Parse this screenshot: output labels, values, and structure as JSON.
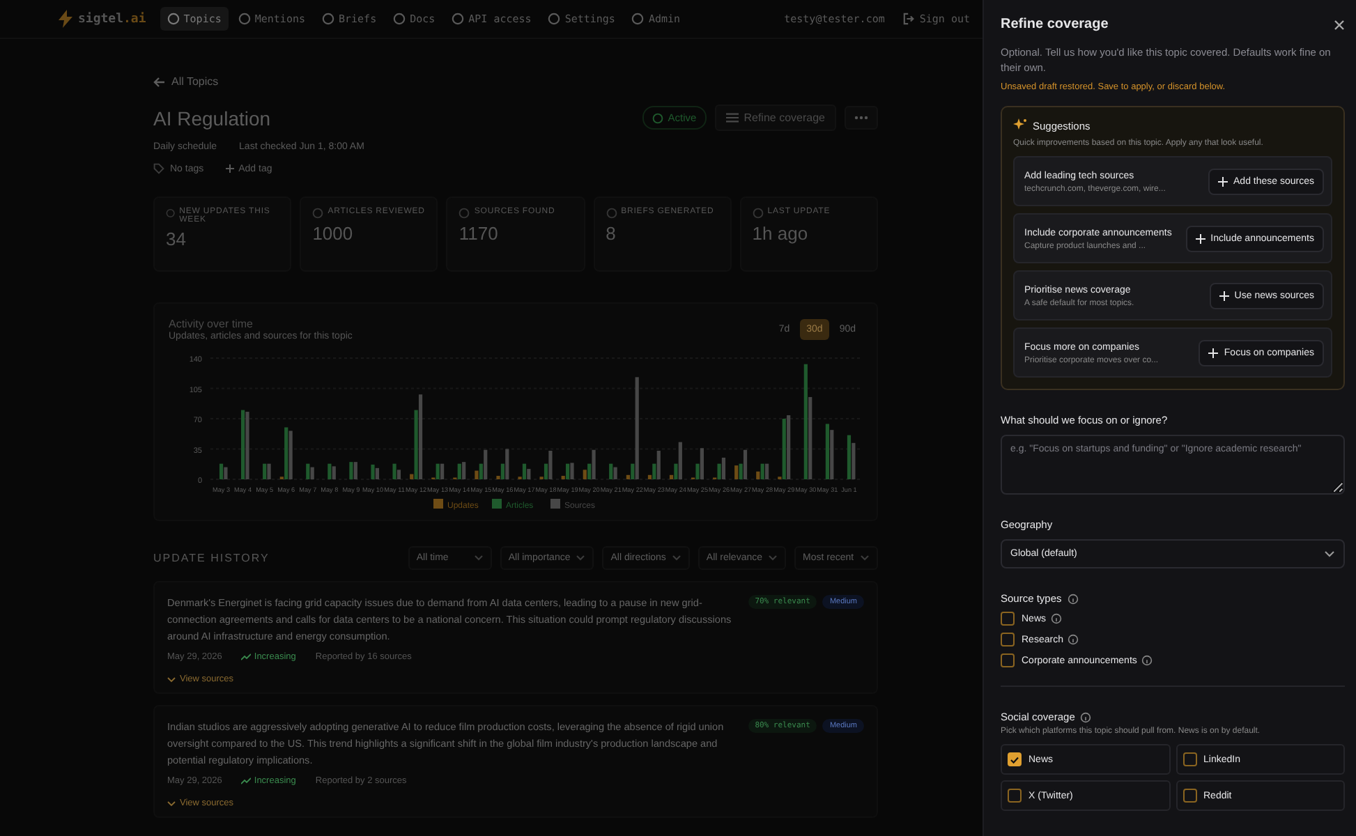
{
  "nav": {
    "logo": {
      "name": "sigtel",
      "suffix": ".ai"
    },
    "items": [
      {
        "label": "Topics",
        "selected": true
      },
      {
        "label": "Mentions",
        "selected": false
      },
      {
        "label": "Briefs",
        "selected": false
      },
      {
        "label": "Docs",
        "selected": false
      },
      {
        "label": "API access",
        "selected": false
      },
      {
        "label": "Settings",
        "selected": false
      },
      {
        "label": "Admin",
        "selected": false
      }
    ],
    "user": "testy@tester.com",
    "sign_out": "Sign out"
  },
  "topic": {
    "back": "All Topics",
    "title": "AI Regulation",
    "status": {
      "label": "Active",
      "active": true
    },
    "refine": "Refine coverage",
    "schedule": "Daily schedule",
    "last_checked": "Last checked Jun 1, 8:00 AM",
    "tags": "No tags",
    "add_tag": "Add tag"
  },
  "stats": [
    {
      "label": "NEW UPDATES THIS WEEK",
      "value": "34"
    },
    {
      "label": "ARTICLES REVIEWED",
      "value": "1000"
    },
    {
      "label": "SOURCES FOUND",
      "value": "1170"
    },
    {
      "label": "BRIEFS GENERATED",
      "value": "8"
    },
    {
      "label": "LAST UPDATE",
      "value": "1h ago"
    }
  ],
  "activity": {
    "title": "Activity over time",
    "subtitle": "Updates, articles and sources for this topic",
    "ranges": [
      {
        "label": "7d",
        "selected": false
      },
      {
        "label": "30d",
        "selected": true
      },
      {
        "label": "90d",
        "selected": false
      }
    ],
    "chart_data": {
      "type": "bar",
      "categories": [
        "May 3",
        "May 4",
        "May 5",
        "May 6",
        "May 7",
        "May 8",
        "May 9",
        "May 10",
        "May 11",
        "May 12",
        "May 13",
        "May 14",
        "May 15",
        "May 16",
        "May 17",
        "May 18",
        "May 19",
        "May 20",
        "May 21",
        "May 22",
        "May 23",
        "May 24",
        "May 25",
        "May 26",
        "May 27",
        "May 28",
        "May 29",
        "May 30",
        "May 31",
        "Jun 1"
      ],
      "series": [
        {
          "name": "Updates",
          "color": "#6e4c15",
          "values": [
            0,
            0,
            0,
            3,
            0,
            0,
            0,
            0,
            0,
            6,
            2,
            2,
            10,
            4,
            3,
            3,
            4,
            11,
            0,
            5,
            5,
            5,
            2,
            2,
            16,
            9,
            3,
            0,
            0,
            0
          ]
        },
        {
          "name": "Articles",
          "color": "#1f5a2d",
          "values": [
            18,
            80,
            18,
            60,
            18,
            18,
            20,
            17,
            18,
            80,
            18,
            18,
            18,
            18,
            18,
            18,
            18,
            18,
            18,
            18,
            18,
            18,
            18,
            18,
            18,
            18,
            70,
            133,
            64,
            51
          ]
        },
        {
          "name": "Sources",
          "color": "#474747",
          "values": [
            14,
            78,
            18,
            56,
            14,
            15,
            20,
            13,
            11,
            98,
            18,
            20,
            34,
            35,
            12,
            33,
            19,
            34,
            14,
            118,
            33,
            43,
            36,
            25,
            34,
            18,
            74,
            95,
            57,
            42
          ]
        }
      ],
      "ylim": [
        0,
        140
      ],
      "yticks": [
        0,
        35,
        70,
        105,
        140
      ],
      "grid": true,
      "legend": true
    }
  },
  "history": {
    "title": "UPDATE HISTORY",
    "filters": [
      "All time",
      "All importance",
      "All directions",
      "All relevance",
      "Most recent"
    ],
    "items": [
      {
        "text": "Denmark's Energinet is facing grid capacity issues due to demand from AI data centers, leading to a pause in new grid-connection agreements and calls for data centers to be a national concern. This situation could prompt regulatory discussions around AI infrastructure and energy consumption.",
        "relevance": "70% relevant",
        "importance": "Medium",
        "date": "May 29, 2026",
        "trend": "Increasing",
        "reported": "Reported by 16 sources",
        "view": "View sources"
      },
      {
        "text": "Indian studios are aggressively adopting generative AI to reduce film production costs, leveraging the absence of rigid union oversight compared to the US. This trend highlights a significant shift in the global film industry's production landscape and potential regulatory implications.",
        "relevance": "80% relevant",
        "importance": "Medium",
        "date": "May 29, 2026",
        "trend": "Increasing",
        "reported": "Reported by 2 sources",
        "view": "View sources"
      }
    ]
  },
  "panel": {
    "title": "Refine coverage",
    "description": "Optional. Tell us how you'd like this topic covered. Defaults work fine on their own.",
    "notice": "Unsaved draft restored. Save to apply, or discard below.",
    "suggestions": {
      "title": "Suggestions",
      "subtitle": "Quick improvements based on this topic. Apply any that look useful.",
      "items": [
        {
          "title": "Add leading tech sources",
          "detail": "techcrunch.com, theverge.com, wire...",
          "action": "Add these sources"
        },
        {
          "title": "Include corporate announcements",
          "detail": "Capture product launches and ...",
          "action": "Include announcements"
        },
        {
          "title": "Prioritise news coverage",
          "detail": "A safe default for most topics.",
          "action": "Use news sources"
        },
        {
          "title": "Focus more on companies",
          "detail": "Prioritise corporate moves over co...",
          "action": "Focus on companies"
        }
      ]
    },
    "focus": {
      "label": "What should we focus on or ignore?",
      "placeholder": "e.g. \"Focus on startups and funding\" or \"Ignore academic research\""
    },
    "geography": {
      "label": "Geography",
      "value": "Global (default)"
    },
    "source_types": {
      "label": "Source types",
      "options": [
        {
          "label": "News",
          "checked": false
        },
        {
          "label": "Research",
          "checked": false
        },
        {
          "label": "Corporate announcements",
          "checked": false
        }
      ]
    },
    "social": {
      "label": "Social coverage",
      "hint": "Pick which platforms this topic should pull from. News is on by default.",
      "options": [
        {
          "label": "News",
          "checked": true
        },
        {
          "label": "LinkedIn",
          "checked": false
        },
        {
          "label": "X (Twitter)",
          "checked": false
        },
        {
          "label": "Reddit",
          "checked": false
        }
      ]
    }
  }
}
